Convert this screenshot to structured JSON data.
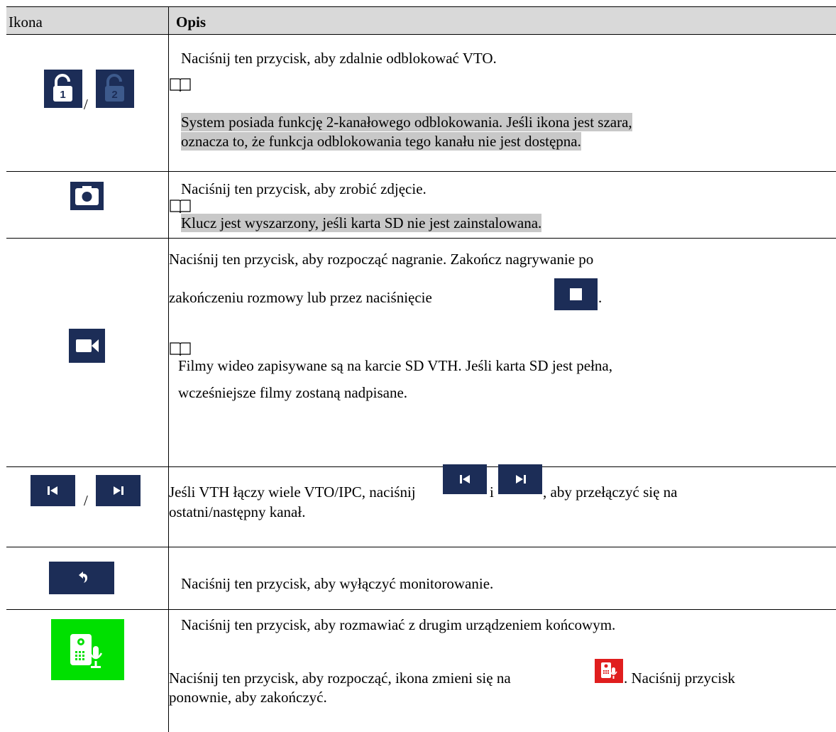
{
  "table": {
    "header": {
      "icon_col": "Ikona",
      "desc_col": "Opis"
    },
    "rows": [
      {
        "icons": [
          "lock-1-icon",
          "lock-2-icon"
        ],
        "separator": "/",
        "lines": [
          "Naciśnij ten przycisk, aby zdalnie odblokować VTO."
        ],
        "note": [
          "System posiada funkcję 2-kanałowego odblokowania. Jeśli ikona jest szara,",
          "oznacza to, że funkcja odblokowania tego kanału nie jest dostępna."
        ]
      },
      {
        "icons": [
          "camera-icon"
        ],
        "lines": [
          "Naciśnij ten przycisk, aby zrobić zdjęcie."
        ],
        "note": [
          "Klucz jest wyszarzony, jeśli karta SD nie jest zainstalowana."
        ]
      },
      {
        "icons": [
          "video-record-icon"
        ],
        "lines": [
          "Naciśnij ten przycisk, aby rozpocząć nagranie. Zakończ nagrywanie po",
          "zakończeniu rozmowy lub przez naciśnięcie",
          "."
        ],
        "note": [
          "Filmy wideo zapisywane są na karcie SD VTH. Jeśli karta SD jest pełna,",
          "wcześniejsze filmy zostaną nadpisane."
        ]
      },
      {
        "icons": [
          "previous-channel-icon",
          "next-channel-icon"
        ],
        "separator": "/",
        "lines": [
          "Jeśli VTH łączy wiele VTO/IPC, naciśnij",
          "i",
          ", aby przełączyć się na",
          "ostatni/następny kanał."
        ]
      },
      {
        "icons": [
          "back-icon"
        ],
        "lines": [
          "Naciśnij ten przycisk, aby wyłączyć monitorowanie."
        ]
      },
      {
        "icons": [
          "talk-icon"
        ],
        "lines": [
          "Naciśnij ten przycisk, aby rozmawiać z drugim urządzeniem końcowym.",
          "Naciśnij ten przycisk, aby rozpocząć, ikona zmieni się na",
          ". Naciśnij przycisk",
          "ponownie, aby zakończyć."
        ]
      }
    ]
  },
  "colors": {
    "icon_navy": "#1c2d57",
    "talk_green": "#00e000",
    "talk_red": "#e01e1e",
    "header_bg": "#d9d9d9",
    "note_highlight": "#c8c8c8"
  }
}
